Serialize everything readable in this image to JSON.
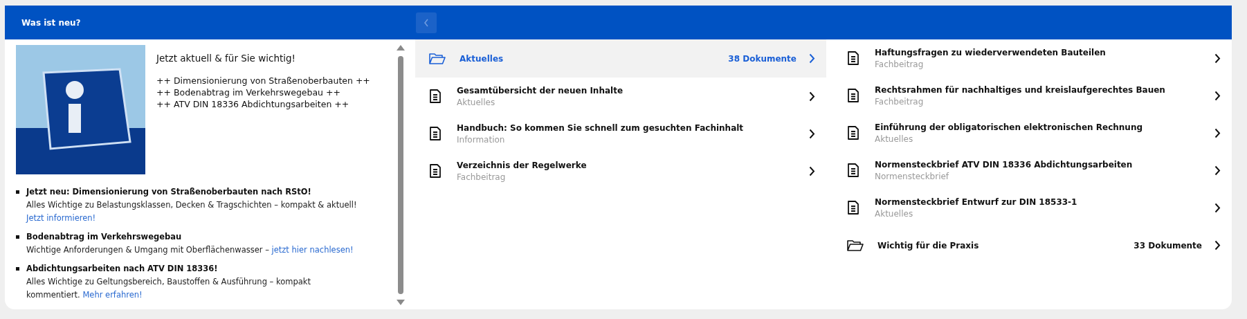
{
  "header": {
    "title": "Was ist neu?"
  },
  "news": {
    "headline": "Jetzt aktuell & für Sie wichtig!",
    "ticker": [
      "++ Dimensionierung von Straßenoberbauten ++",
      "++ Bodenabtrag im Verkehrswegebau ++",
      "++ ATV DIN 18336 Abdichtungsarbeiten ++"
    ],
    "items": [
      {
        "title": "Jetzt neu: Dimensionierung von Straßenoberbauten nach RStO!",
        "text": "Alles Wichtige zu Belastungsklassen, Decken & Tragschichten – kompakt & aktuell!",
        "link": "Jetzt informieren!"
      },
      {
        "title": "Bodenabtrag im Verkehrswegebau",
        "text": "Wichtige Anforderungen & Umgang mit Oberflächenwasser –",
        "link": "jetzt hier nachlesen!"
      },
      {
        "title": "Abdichtungsarbeiten nach ATV DIN 18336!",
        "text": "Alles Wichtige zu Geltungsbereich, Baustoffen & Ausführung – kompakt kommentiert.",
        "link": "Mehr erfahren!"
      }
    ]
  },
  "columns": [
    {
      "items": [
        {
          "kind": "folder",
          "title": "Aktuelles",
          "count": "38 Dokumente",
          "selected": true
        },
        {
          "kind": "document",
          "title": "Gesamtübersicht der neuen Inhalte",
          "category": "Aktuelles",
          "selected": false
        },
        {
          "kind": "document",
          "title": "Handbuch: So kommen Sie schnell zum gesuchten Fachinhalt",
          "category": "Information",
          "selected": false
        },
        {
          "kind": "document",
          "title": "Verzeichnis der Regelwerke",
          "category": "Fachbeitrag",
          "selected": false
        }
      ]
    },
    {
      "items": [
        {
          "kind": "document",
          "title": "Haftungsfragen zu wiederverwendeten Bauteilen",
          "category": "Fachbeitrag",
          "selected": false
        },
        {
          "kind": "document",
          "title": "Rechtsrahmen für nachhaltiges und kreislaufgerechtes Bauen",
          "category": "Fachbeitrag",
          "selected": false
        },
        {
          "kind": "document",
          "title": "Einführung der obligatorischen elektronischen Rechnung",
          "category": "Aktuelles",
          "selected": false
        },
        {
          "kind": "document",
          "title": "Normensteckbrief ATV DIN 18336 Abdichtungsarbeiten",
          "category": "Normensteckbrief",
          "selected": false
        },
        {
          "kind": "document",
          "title": "Normensteckbrief Entwurf zur DIN 18533-1",
          "category": "Aktuelles",
          "selected": false
        },
        {
          "kind": "folder",
          "title": "Wichtig für die Praxis",
          "count": "33 Dokumente",
          "selected": false
        }
      ]
    }
  ]
}
